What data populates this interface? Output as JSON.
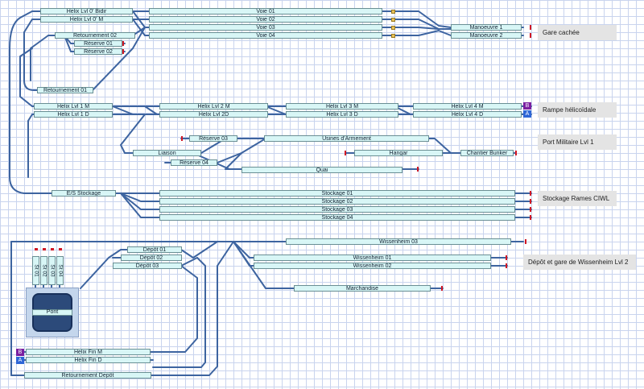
{
  "zones": {
    "gare_cachee": "Gare cachée",
    "rampe": "Rampe hélicoïdale",
    "port": "Port Militaire Lvl 1",
    "stockage": "Stockage Rames CIWL",
    "depot": "Dépôt et gare de Wissenheim Lvl 2"
  },
  "blocks": {
    "helix0_bidir": "Helix Lvl 0' Bidir",
    "helix0_m": "Helix Lvl 0' M",
    "retournement02": "Retournement 02",
    "reserve01": "Réserve 01",
    "reserve02": "Réserve 02",
    "retournement01": "Retournement 01",
    "voie01": "Voie 01",
    "voie02": "Voie 02",
    "voie03": "Voie 03",
    "voie04": "Voie 04",
    "manoeuvre1": "Manoeuvre 1",
    "manoeuvre2": "Manoeuvre 2",
    "helix1m": "Helix Lvl 1 M",
    "helix1d": "Helix Lvl 1 D",
    "helix2m": "Helix Lvl 2 M",
    "helix2d": "Helix Lvl 2D",
    "helix3m": "Helix Lvl 3 M",
    "helix3d": "Helix Lvl 3 D",
    "helix4m": "Helix Lvl 4 M",
    "helix4d": "Helix Lvl 4 D",
    "reserve03": "Réserve 03",
    "usines": "Usines d'Armement",
    "liaison": "Liaison",
    "hangar": "Hangar",
    "chantier": "Chantier Bunker",
    "reserve04": "Réserve 04",
    "quai": "Quai",
    "es_stockage": "E/S Stockage",
    "stockage01": "Stockage 01",
    "stockage02": "Stockage 02",
    "stockage03": "Stockage 03",
    "stockage04": "Stockage 04",
    "wissenheim03": "Wissenheim 03",
    "depot01": "Dépôt 01",
    "depot02": "Dépôt 02",
    "depot03": "Dépôt 03",
    "wissenheim01": "Wissenheim 01",
    "wissenheim02": "Wissenheim 02",
    "marchandise": "Marchandise",
    "pont": "Pont",
    "helix_fin_m": "Helix Fin M",
    "helix_fin_d": "Helix Fin D",
    "retournement_depot": "Retournement Depôt",
    "st01": "St 01",
    "st02": "St 02",
    "st03": "St 03",
    "st04": "St 04"
  },
  "indicators": {
    "b_top": "B",
    "a_top": "A",
    "b_bottom": "B",
    "a_bottom": "A"
  },
  "colors": {
    "track": "#3d64a0",
    "indicator_b": "#7a1fa0",
    "indicator_a": "#2e66d6",
    "signal": "#d01825",
    "block_fill": "#d8f6f6"
  }
}
